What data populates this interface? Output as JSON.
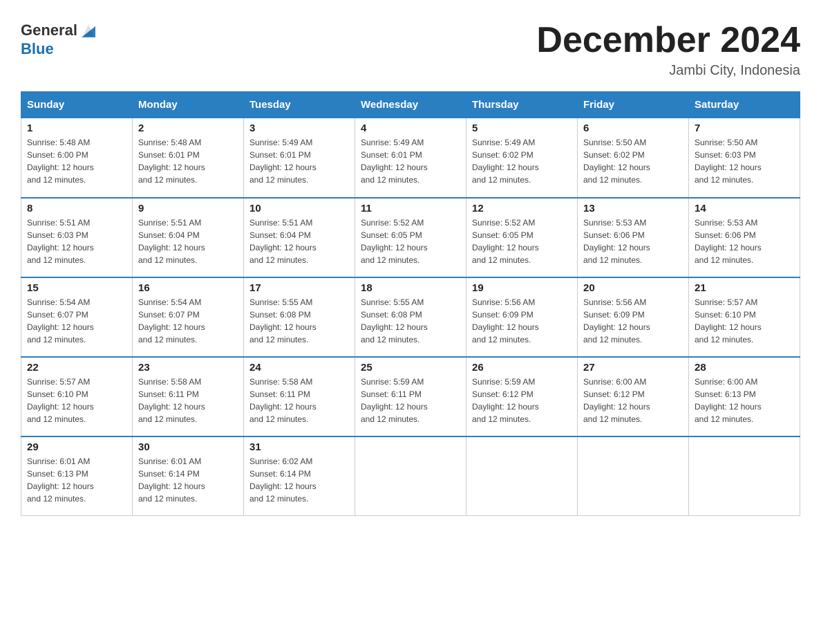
{
  "header": {
    "logo_general": "General",
    "logo_blue": "Blue",
    "month_title": "December 2024",
    "location": "Jambi City, Indonesia"
  },
  "days_of_week": [
    "Sunday",
    "Monday",
    "Tuesday",
    "Wednesday",
    "Thursday",
    "Friday",
    "Saturday"
  ],
  "weeks": [
    [
      {
        "day": "1",
        "sunrise": "5:48 AM",
        "sunset": "6:00 PM",
        "daylight": "12 hours and 12 minutes."
      },
      {
        "day": "2",
        "sunrise": "5:48 AM",
        "sunset": "6:01 PM",
        "daylight": "12 hours and 12 minutes."
      },
      {
        "day": "3",
        "sunrise": "5:49 AM",
        "sunset": "6:01 PM",
        "daylight": "12 hours and 12 minutes."
      },
      {
        "day": "4",
        "sunrise": "5:49 AM",
        "sunset": "6:01 PM",
        "daylight": "12 hours and 12 minutes."
      },
      {
        "day": "5",
        "sunrise": "5:49 AM",
        "sunset": "6:02 PM",
        "daylight": "12 hours and 12 minutes."
      },
      {
        "day": "6",
        "sunrise": "5:50 AM",
        "sunset": "6:02 PM",
        "daylight": "12 hours and 12 minutes."
      },
      {
        "day": "7",
        "sunrise": "5:50 AM",
        "sunset": "6:03 PM",
        "daylight": "12 hours and 12 minutes."
      }
    ],
    [
      {
        "day": "8",
        "sunrise": "5:51 AM",
        "sunset": "6:03 PM",
        "daylight": "12 hours and 12 minutes."
      },
      {
        "day": "9",
        "sunrise": "5:51 AM",
        "sunset": "6:04 PM",
        "daylight": "12 hours and 12 minutes."
      },
      {
        "day": "10",
        "sunrise": "5:51 AM",
        "sunset": "6:04 PM",
        "daylight": "12 hours and 12 minutes."
      },
      {
        "day": "11",
        "sunrise": "5:52 AM",
        "sunset": "6:05 PM",
        "daylight": "12 hours and 12 minutes."
      },
      {
        "day": "12",
        "sunrise": "5:52 AM",
        "sunset": "6:05 PM",
        "daylight": "12 hours and 12 minutes."
      },
      {
        "day": "13",
        "sunrise": "5:53 AM",
        "sunset": "6:06 PM",
        "daylight": "12 hours and 12 minutes."
      },
      {
        "day": "14",
        "sunrise": "5:53 AM",
        "sunset": "6:06 PM",
        "daylight": "12 hours and 12 minutes."
      }
    ],
    [
      {
        "day": "15",
        "sunrise": "5:54 AM",
        "sunset": "6:07 PM",
        "daylight": "12 hours and 12 minutes."
      },
      {
        "day": "16",
        "sunrise": "5:54 AM",
        "sunset": "6:07 PM",
        "daylight": "12 hours and 12 minutes."
      },
      {
        "day": "17",
        "sunrise": "5:55 AM",
        "sunset": "6:08 PM",
        "daylight": "12 hours and 12 minutes."
      },
      {
        "day": "18",
        "sunrise": "5:55 AM",
        "sunset": "6:08 PM",
        "daylight": "12 hours and 12 minutes."
      },
      {
        "day": "19",
        "sunrise": "5:56 AM",
        "sunset": "6:09 PM",
        "daylight": "12 hours and 12 minutes."
      },
      {
        "day": "20",
        "sunrise": "5:56 AM",
        "sunset": "6:09 PM",
        "daylight": "12 hours and 12 minutes."
      },
      {
        "day": "21",
        "sunrise": "5:57 AM",
        "sunset": "6:10 PM",
        "daylight": "12 hours and 12 minutes."
      }
    ],
    [
      {
        "day": "22",
        "sunrise": "5:57 AM",
        "sunset": "6:10 PM",
        "daylight": "12 hours and 12 minutes."
      },
      {
        "day": "23",
        "sunrise": "5:58 AM",
        "sunset": "6:11 PM",
        "daylight": "12 hours and 12 minutes."
      },
      {
        "day": "24",
        "sunrise": "5:58 AM",
        "sunset": "6:11 PM",
        "daylight": "12 hours and 12 minutes."
      },
      {
        "day": "25",
        "sunrise": "5:59 AM",
        "sunset": "6:11 PM",
        "daylight": "12 hours and 12 minutes."
      },
      {
        "day": "26",
        "sunrise": "5:59 AM",
        "sunset": "6:12 PM",
        "daylight": "12 hours and 12 minutes."
      },
      {
        "day": "27",
        "sunrise": "6:00 AM",
        "sunset": "6:12 PM",
        "daylight": "12 hours and 12 minutes."
      },
      {
        "day": "28",
        "sunrise": "6:00 AM",
        "sunset": "6:13 PM",
        "daylight": "12 hours and 12 minutes."
      }
    ],
    [
      {
        "day": "29",
        "sunrise": "6:01 AM",
        "sunset": "6:13 PM",
        "daylight": "12 hours and 12 minutes."
      },
      {
        "day": "30",
        "sunrise": "6:01 AM",
        "sunset": "6:14 PM",
        "daylight": "12 hours and 12 minutes."
      },
      {
        "day": "31",
        "sunrise": "6:02 AM",
        "sunset": "6:14 PM",
        "daylight": "12 hours and 12 minutes."
      },
      null,
      null,
      null,
      null
    ]
  ],
  "labels": {
    "sunrise": "Sunrise:",
    "sunset": "Sunset:",
    "daylight": "Daylight:"
  }
}
